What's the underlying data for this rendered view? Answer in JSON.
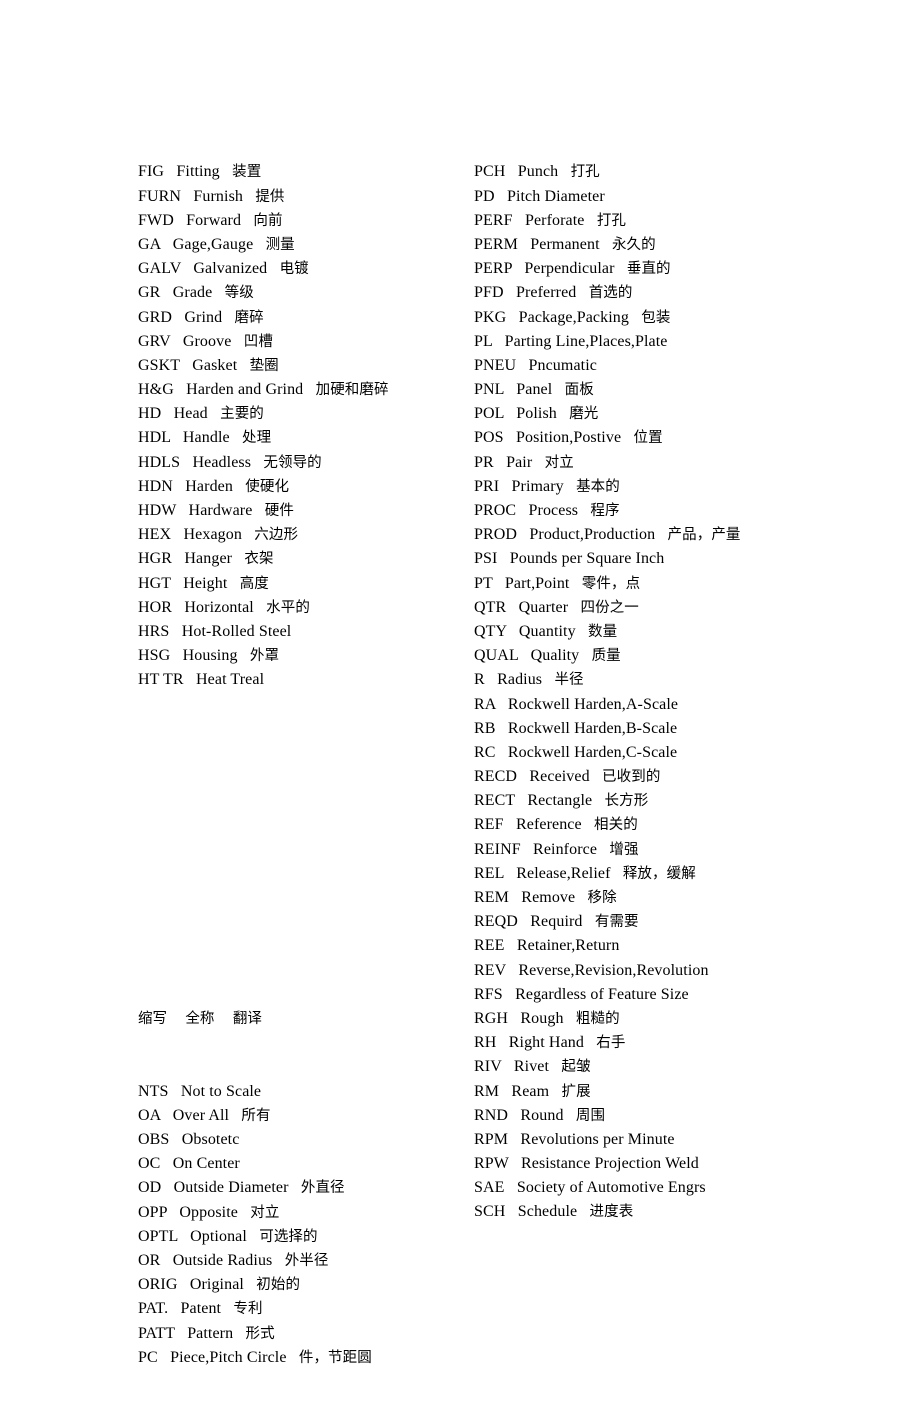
{
  "document": {
    "type": "abbreviation-glossary",
    "page_background": "#ffffff",
    "text_color": "#000000",
    "section_header": {
      "abbr_col": "缩写",
      "full_col": "全称",
      "translation_col": "翻译",
      "line": "缩写    全称    翻译"
    }
  },
  "left_column": {
    "blank_gap_lines": 9,
    "entries_before_gap": [
      {
        "abbr": "FIG",
        "full": "Fitting",
        "trans": "装置"
      },
      {
        "abbr": "FURN",
        "full": "Furnish",
        "trans": "提供"
      },
      {
        "abbr": "FWD",
        "full": "Forward",
        "trans": "向前"
      },
      {
        "abbr": "GA",
        "full": "Gage,Gauge",
        "trans": "测量"
      },
      {
        "abbr": "GALV",
        "full": "Galvanized",
        "trans": "电镀"
      },
      {
        "abbr": "GR",
        "full": "Grade",
        "trans": "等级"
      },
      {
        "abbr": "GRD",
        "full": "Grind",
        "trans": "磨碎"
      },
      {
        "abbr": "GRV",
        "full": "Groove",
        "trans": "凹槽"
      },
      {
        "abbr": "GSKT",
        "full": "Gasket",
        "trans": "垫圈"
      },
      {
        "abbr": "H&G",
        "full": "Harden and Grind",
        "trans": "加硬和磨碎"
      },
      {
        "abbr": "HD",
        "full": "Head",
        "trans": "主要的"
      },
      {
        "abbr": "HDL",
        "full": "Handle",
        "trans": "处理"
      },
      {
        "abbr": "HDLS",
        "full": "Headless",
        "trans": "无领导的"
      },
      {
        "abbr": "HDN",
        "full": "Harden",
        "trans": "使硬化"
      },
      {
        "abbr": "HDW",
        "full": "Hardware",
        "trans": "硬件"
      },
      {
        "abbr": "HEX",
        "full": "Hexagon",
        "trans": "六边形"
      },
      {
        "abbr": "HGR",
        "full": "Hanger",
        "trans": "衣架"
      },
      {
        "abbr": "HGT",
        "full": "Height",
        "trans": "高度"
      },
      {
        "abbr": "HOR",
        "full": "Horizontal",
        "trans": "水平的"
      },
      {
        "abbr": "HRS",
        "full": "Hot-Rolled Steel",
        "trans": ""
      },
      {
        "abbr": "HSG",
        "full": "Housing",
        "trans": "外罩"
      },
      {
        "abbr": "HT TR",
        "full": "Heat Treal",
        "trans": ""
      }
    ],
    "entries_after_gap": [
      {
        "abbr": "NTS",
        "full": "Not to Scale",
        "trans": ""
      },
      {
        "abbr": "OA",
        "full": "Over All",
        "trans": "所有"
      },
      {
        "abbr": "OBS",
        "full": "Obsotetc",
        "trans": ""
      },
      {
        "abbr": "OC",
        "full": "On Center",
        "trans": ""
      },
      {
        "abbr": "OD",
        "full": "Outside Diameter",
        "trans": "外直径"
      },
      {
        "abbr": "OPP",
        "full": "Opposite",
        "trans": "对立"
      },
      {
        "abbr": "OPTL",
        "full": "Optional",
        "trans": "可选择的"
      },
      {
        "abbr": "OR",
        "full": "Outside Radius",
        "trans": "外半径"
      },
      {
        "abbr": "ORIG",
        "full": "Original",
        "trans": "初始的"
      },
      {
        "abbr": "PAT.",
        "full": "Patent",
        "trans": "专利"
      },
      {
        "abbr": "PATT",
        "full": "Pattern",
        "trans": "形式"
      },
      {
        "abbr": "PC",
        "full": "Piece,Pitch Circle",
        "trans": "件，节距圆"
      }
    ]
  },
  "right_column": {
    "entries": [
      {
        "abbr": "PCH",
        "full": "Punch",
        "trans": "打孔"
      },
      {
        "abbr": "PD",
        "full": "Pitch Diameter",
        "trans": ""
      },
      {
        "abbr": "PERF",
        "full": "Perforate",
        "trans": "打孔"
      },
      {
        "abbr": "PERM",
        "full": "Permanent",
        "trans": "永久的"
      },
      {
        "abbr": "PERP",
        "full": "Perpendicular",
        "trans": "垂直的"
      },
      {
        "abbr": "PFD",
        "full": "Preferred",
        "trans": "首选的"
      },
      {
        "abbr": "PKG",
        "full": "Package,Packing",
        "trans": "包装"
      },
      {
        "abbr": "PL",
        "full": "Parting Line,Places,Plate",
        "trans": ""
      },
      {
        "abbr": "PNEU",
        "full": "Pncumatic",
        "trans": ""
      },
      {
        "abbr": "PNL",
        "full": "Panel",
        "trans": "面板"
      },
      {
        "abbr": "POL",
        "full": "Polish",
        "trans": "磨光"
      },
      {
        "abbr": "POS",
        "full": "Position,Postive",
        "trans": "位置"
      },
      {
        "abbr": "PR",
        "full": "Pair",
        "trans": "对立"
      },
      {
        "abbr": "PRI",
        "full": "Primary",
        "trans": "基本的"
      },
      {
        "abbr": "PROC",
        "full": "Process",
        "trans": "程序"
      },
      {
        "abbr": "PROD",
        "full": "Product,Production",
        "trans": "产品，产量"
      },
      {
        "abbr": "PSI",
        "full": "Pounds per Square Inch",
        "trans": ""
      },
      {
        "abbr": "PT",
        "full": "Part,Point",
        "trans": "零件，点"
      },
      {
        "abbr": "QTR",
        "full": "Quarter",
        "trans": "四份之一"
      },
      {
        "abbr": "QTY",
        "full": "Quantity",
        "trans": "数量"
      },
      {
        "abbr": "QUAL",
        "full": "Quality",
        "trans": "质量"
      },
      {
        "abbr": "R",
        "full": "Radius",
        "trans": "半径"
      },
      {
        "abbr": "RA",
        "full": "Rockwell Harden,A-Scale",
        "trans": ""
      },
      {
        "abbr": "RB",
        "full": "Rockwell Harden,B-Scale",
        "trans": ""
      },
      {
        "abbr": "RC",
        "full": "Rockwell Harden,C-Scale",
        "trans": ""
      },
      {
        "abbr": "RECD",
        "full": "Received",
        "trans": "已收到的"
      },
      {
        "abbr": "RECT",
        "full": "Rectangle",
        "trans": "长方形"
      },
      {
        "abbr": "REF",
        "full": "Reference",
        "trans": "相关的"
      },
      {
        "abbr": "REINF",
        "full": "Reinforce",
        "trans": "增强"
      },
      {
        "abbr": "REL",
        "full": "Release,Relief",
        "trans": "释放，缓解"
      },
      {
        "abbr": "REM",
        "full": "Remove",
        "trans": "移除"
      },
      {
        "abbr": "REQD",
        "full": "Requird",
        "trans": "有需要"
      },
      {
        "abbr": "REE",
        "full": "Retainer,Return",
        "trans": ""
      },
      {
        "abbr": "REV",
        "full": "Reverse,Revision,Revolution",
        "trans": ""
      },
      {
        "abbr": "RFS",
        "full": "Regardless of Feature Size",
        "trans": ""
      },
      {
        "abbr": "RGH",
        "full": "Rough",
        "trans": "粗糙的"
      },
      {
        "abbr": "RH",
        "full": "Right Hand",
        "trans": "右手"
      },
      {
        "abbr": "RIV",
        "full": "Rivet",
        "trans": "起皱"
      },
      {
        "abbr": "RM",
        "full": "Ream",
        "trans": "扩展"
      },
      {
        "abbr": "RND",
        "full": "Round",
        "trans": "周围"
      },
      {
        "abbr": "RPM",
        "full": "Revolutions per Minute",
        "trans": ""
      },
      {
        "abbr": "RPW",
        "full": "Resistance Projection Weld",
        "trans": ""
      },
      {
        "abbr": "SAE",
        "full": "Society of Automotive Engrs",
        "trans": ""
      },
      {
        "abbr": "SCH",
        "full": "Schedule",
        "trans": "进度表"
      }
    ]
  }
}
